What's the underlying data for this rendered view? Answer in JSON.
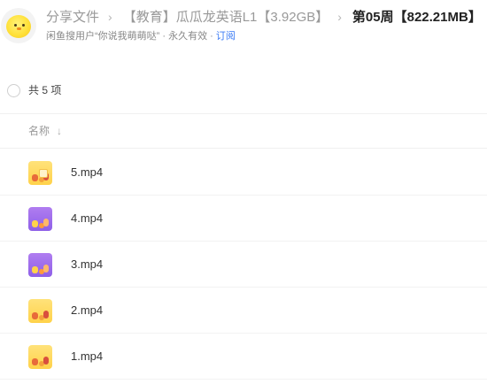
{
  "header": {
    "breadcrumbs": [
      "分享文件",
      "【教育】瓜瓜龙英语L1【3.92GB】",
      "第05周【822.21MB】"
    ],
    "separator": "›",
    "sharer_text": "闲鱼搜用户“你说我萌萌哒”",
    "validity_text": "· 永久有效 ·",
    "subscribe_label": "订阅"
  },
  "list": {
    "count_text": "共 5 项",
    "name_header": "名称",
    "sort_glyph": "↓",
    "items": [
      {
        "name": "5.mp4",
        "thumb_style": "yellow"
      },
      {
        "name": "4.mp4",
        "thumb_style": "purple"
      },
      {
        "name": "3.mp4",
        "thumb_style": "purple"
      },
      {
        "name": "2.mp4",
        "thumb_style": "yellow"
      },
      {
        "name": "1.mp4",
        "thumb_style": "yellow"
      }
    ]
  }
}
